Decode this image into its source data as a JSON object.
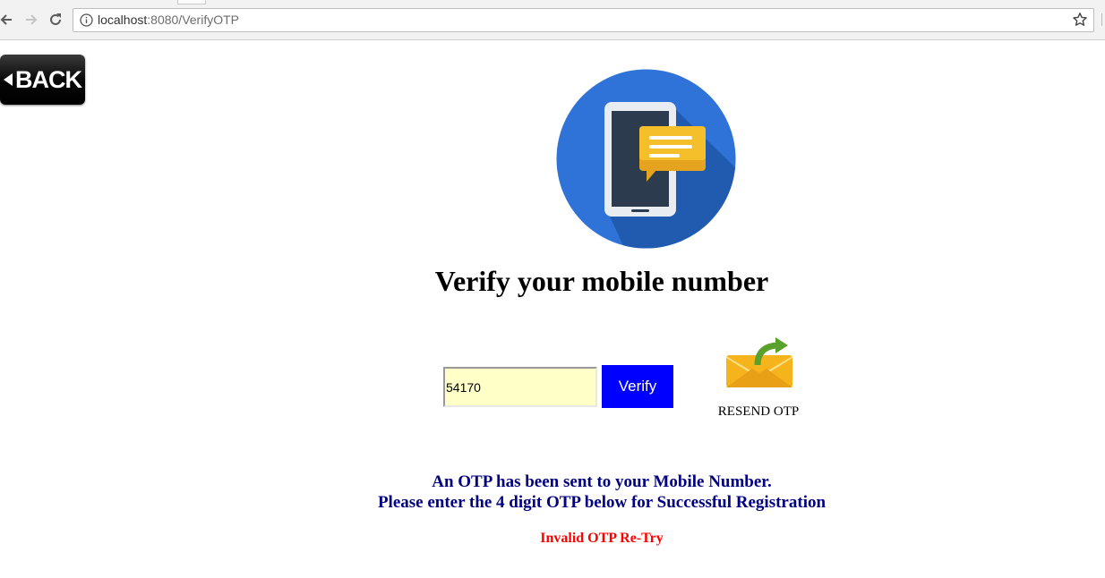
{
  "browser": {
    "url_host": "localhost",
    "url_path": ":8080/VerifyOTP"
  },
  "back_button": {
    "label": "BACK"
  },
  "page": {
    "title": "Verify your mobile number",
    "otp_input": {
      "value": "54170"
    },
    "verify_label": "Verify",
    "resend_label": "RESEND OTP",
    "message_line1": "An OTP has been sent to your Mobile Number.",
    "message_line2": "Please enter the 4 digit OTP below for Successful Registration",
    "error": "Invalid OTP Re-Try"
  },
  "colors": {
    "verify_button": "#0000ff",
    "message_text": "#000080",
    "error_text": "#ff0000",
    "otp_input_bg": "#ffffc8"
  },
  "icons": [
    "back-arrow-icon",
    "forward-arrow-icon",
    "reload-icon",
    "info-icon",
    "bookmark-star-icon",
    "phone-message-illustration",
    "envelope-icon"
  ]
}
